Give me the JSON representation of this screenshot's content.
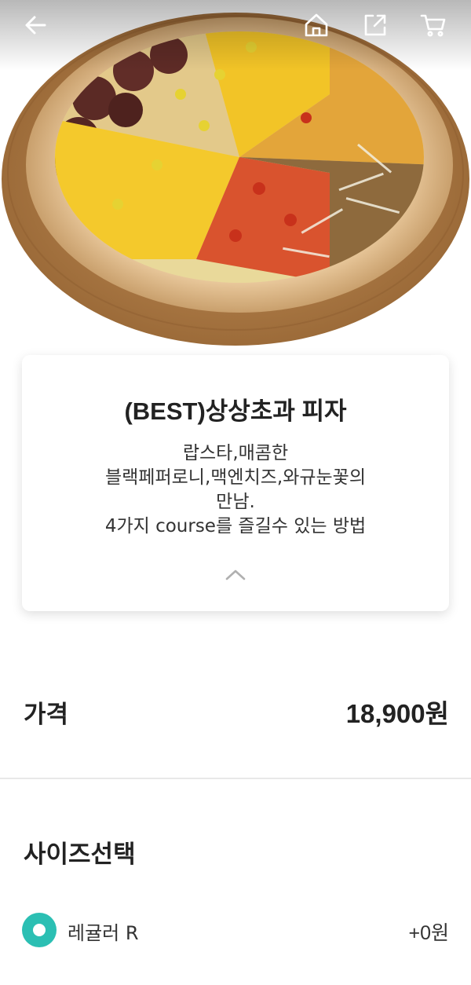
{
  "header": {
    "icons": [
      "arrow-left-icon",
      "home-icon",
      "share-icon",
      "cart-icon"
    ],
    "icon_color": "#ffffff"
  },
  "product": {
    "title": "(BEST)상상초과 피자",
    "description_lines": [
      "랍스타,매콤한",
      "블랙페퍼로니,맥엔치즈,와규눈꽃의",
      "만남.",
      "4가지 course를 즐길수 있는 방법"
    ]
  },
  "price": {
    "label": "가격",
    "value": "18,900원"
  },
  "size_section": {
    "title": "사이즈선택",
    "options": [
      {
        "label": "레귤러 R",
        "price": "+0원",
        "selected": true
      }
    ]
  },
  "colors": {
    "accent": "#2bbfb3",
    "text": "#222222",
    "divider": "#e8e8e8"
  }
}
